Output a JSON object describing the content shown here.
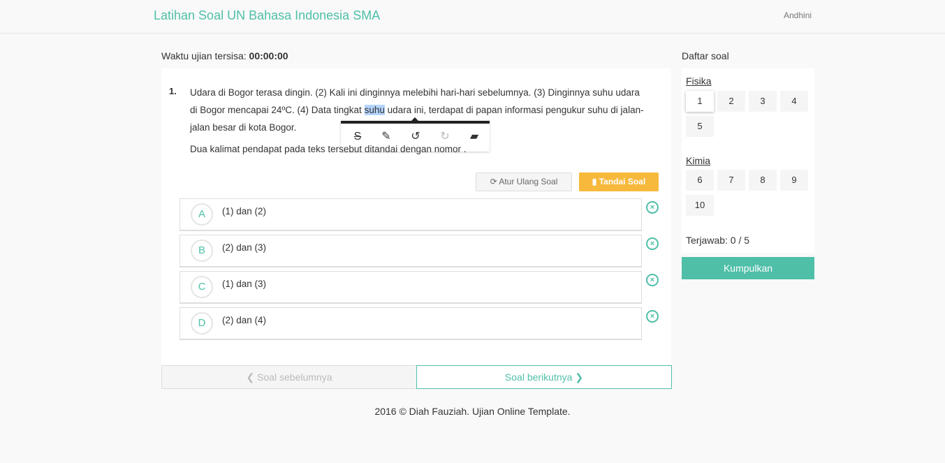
{
  "header": {
    "title": "Latihan Soal UN Bahasa Indonesia SMA",
    "user": "Andhini"
  },
  "timer": {
    "label": "Waktu ujian tersisa:",
    "value": "00:00:00"
  },
  "question": {
    "number": "1.",
    "text_before": "Udara di Bogor terasa dingin. (2) Kali ini dinginnya melebihi hari-hari sebelumnya. (3) Dinginnya suhu udara di Bogor mencapai 24ºC. (4) Data tingkat ",
    "highlight": "suhu",
    "text_after": " udara ini, terdapat di papan informasi pengukur suhu di jalan-jalan besar di kota Bogor.",
    "prompt": "Dua kalimat pendapat pada teks tersebut ditandai dengan nomor ."
  },
  "toolbar": {
    "tools": [
      "strikethrough-icon",
      "pencil-icon",
      "undo-icon",
      "redo-icon",
      "eraser-icon"
    ]
  },
  "actions": {
    "reset_label": "Atur Ulang Soal",
    "mark_label": "Tandai Soal"
  },
  "options": [
    {
      "letter": "A",
      "text": "(1) dan (2)"
    },
    {
      "letter": "B",
      "text": " (2) dan (3)"
    },
    {
      "letter": "C",
      "text": "(1) dan (3)"
    },
    {
      "letter": "D",
      "text": "(2) dan (4)"
    }
  ],
  "nav": {
    "prev_label": "Soal sebelumnya",
    "next_label": "Soal berikutnya"
  },
  "footer": "2016 © Diah Fauziah. Ujian Online Template.",
  "sidebar": {
    "title": "Daftar soal",
    "categories": [
      {
        "name": "Fisika",
        "numbers": [
          "1",
          "2",
          "3",
          "4",
          "5"
        ]
      },
      {
        "name": "Kimia",
        "numbers": [
          "6",
          "7",
          "8",
          "9",
          "10"
        ]
      }
    ],
    "active": "1",
    "answered_label": "Terjawab: 0 / 5",
    "submit_label": "Kumpulkan"
  },
  "colors": {
    "accent": "#4fbfa8",
    "mark": "#f6b93b"
  }
}
